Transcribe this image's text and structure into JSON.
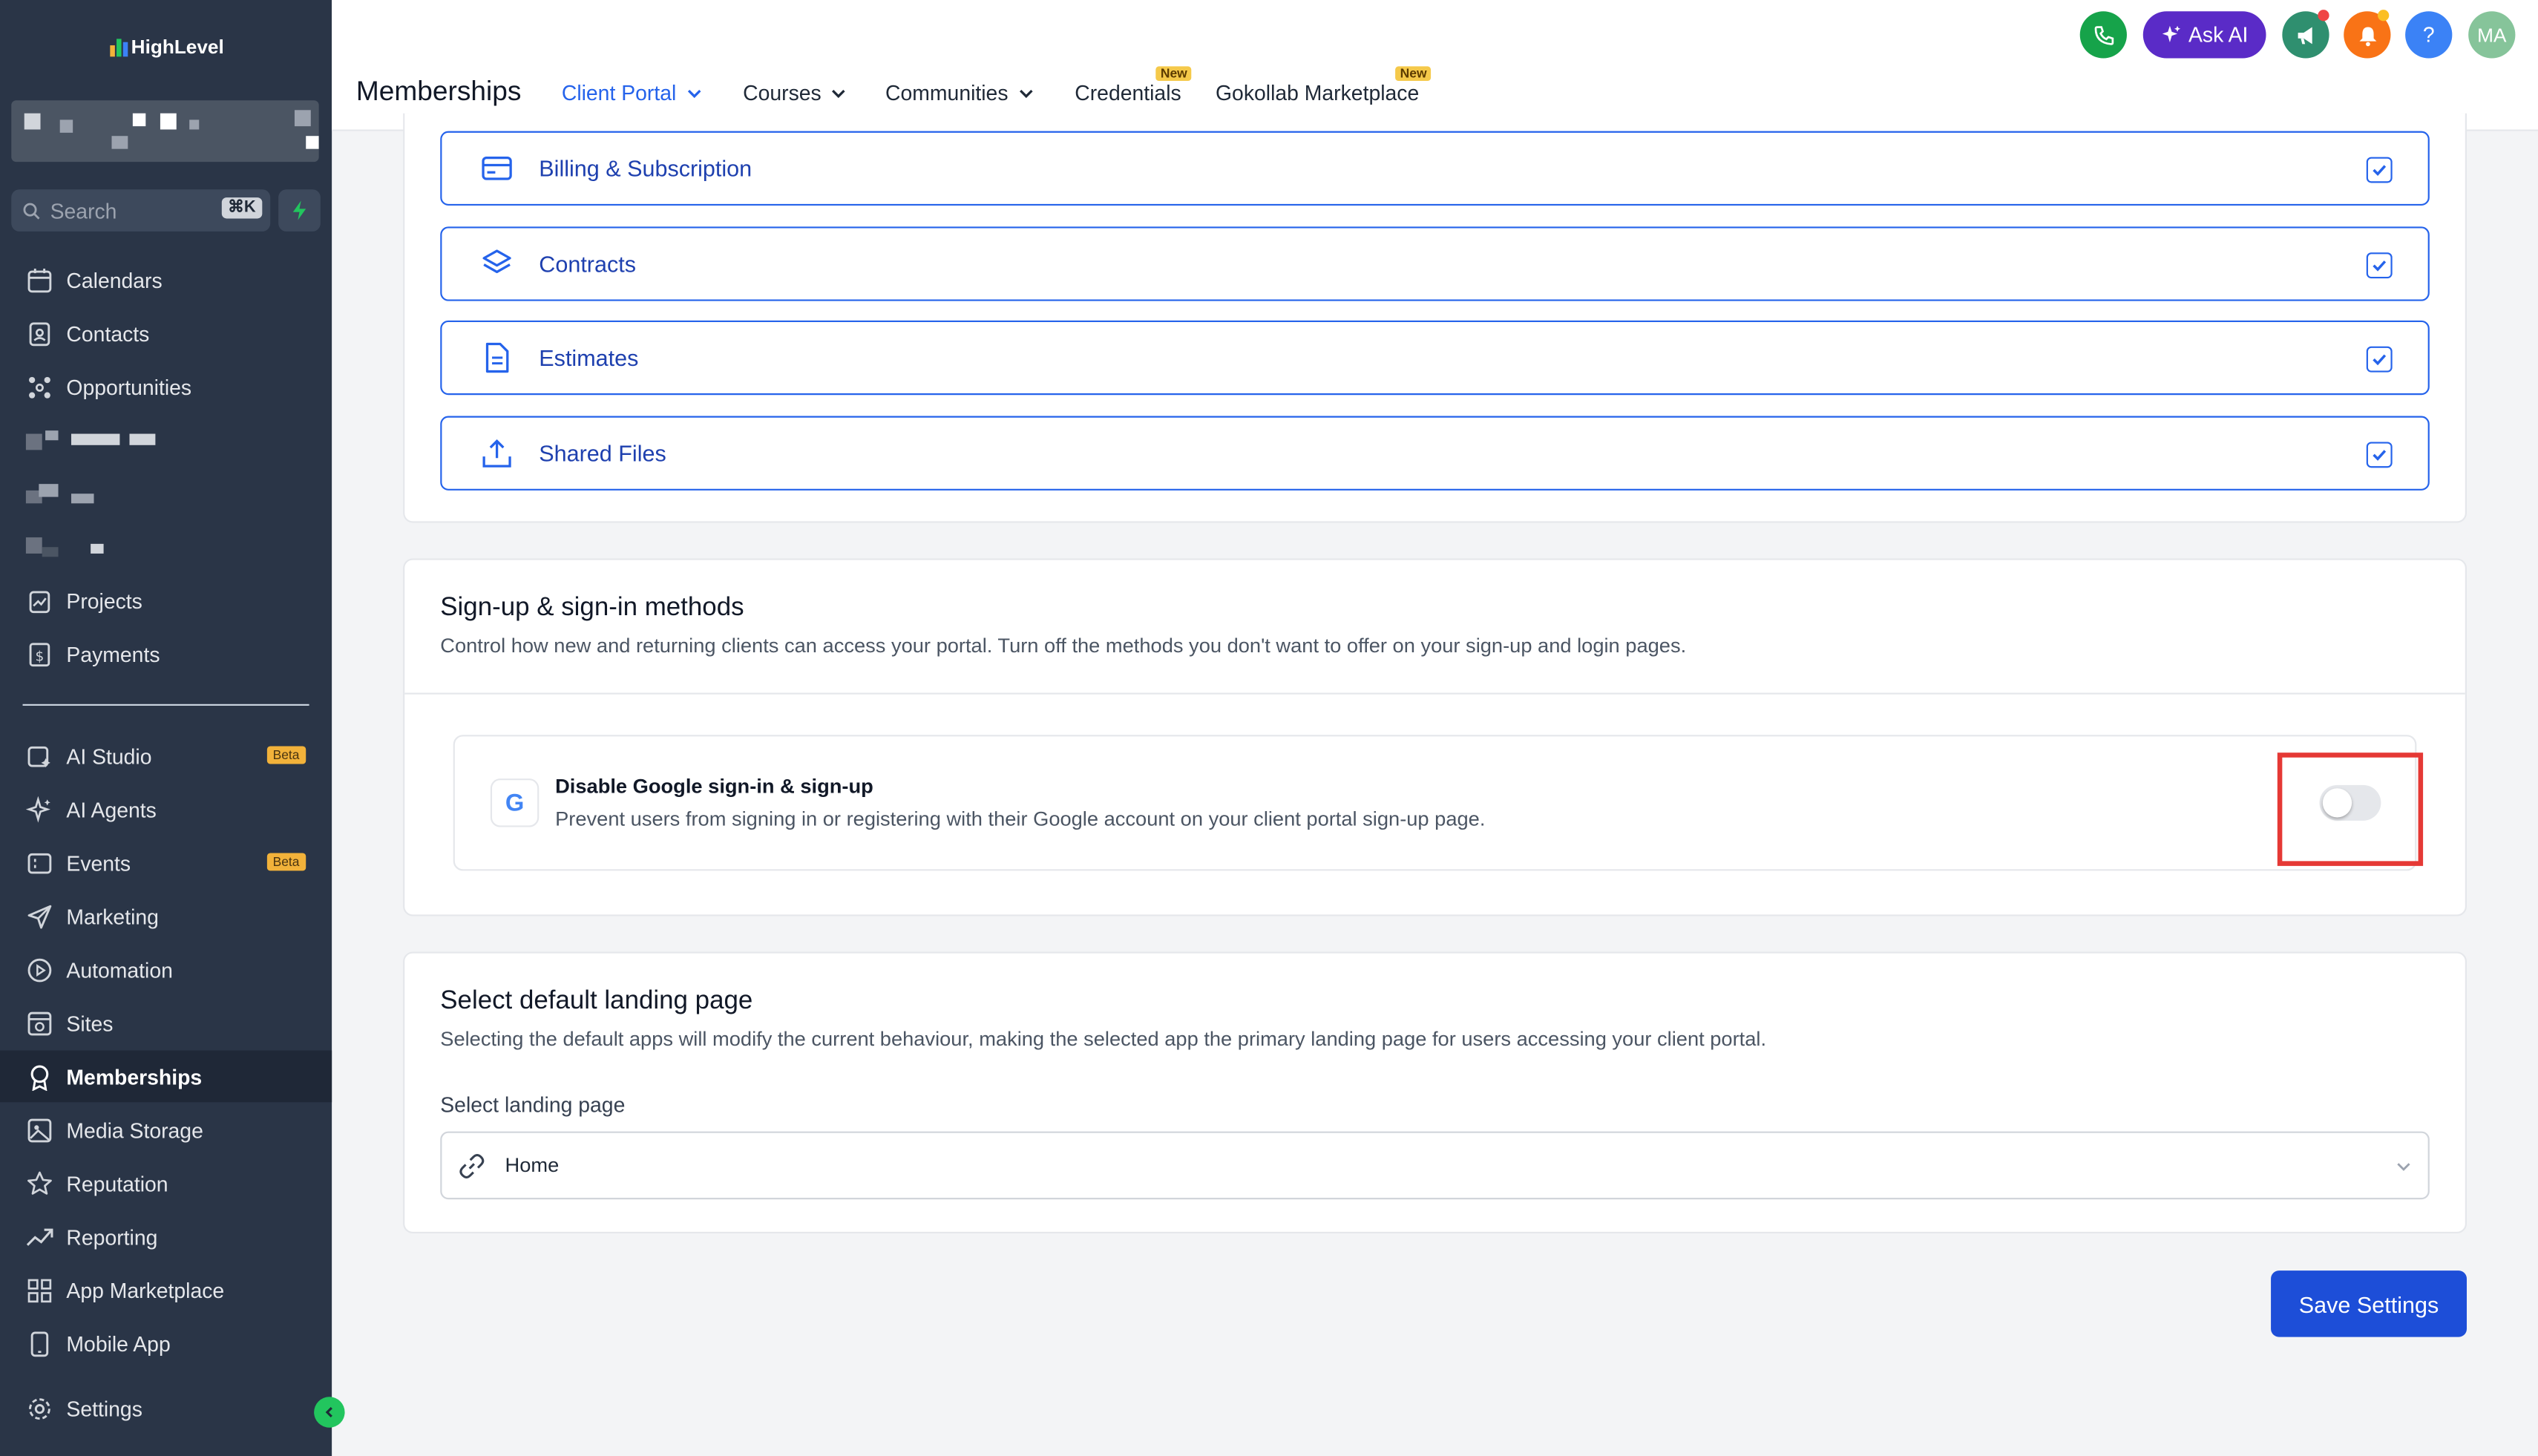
{
  "brand": {
    "name": "HighLevel"
  },
  "sidebar": {
    "search_placeholder": "Search",
    "search_shortcut": "⌘K",
    "items": [
      {
        "label": "Calendars",
        "icon": "calendar-icon"
      },
      {
        "label": "Contacts",
        "icon": "contacts-icon"
      },
      {
        "label": "Opportunities",
        "icon": "opportunities-icon"
      },
      {
        "label": "Projects",
        "icon": "projects-icon"
      },
      {
        "label": "Payments",
        "icon": "payments-icon"
      },
      {
        "label": "AI Studio",
        "icon": "ai-studio-icon",
        "badge": "Beta"
      },
      {
        "label": "AI Agents",
        "icon": "ai-agents-icon"
      },
      {
        "label": "Events",
        "icon": "events-icon",
        "badge": "Beta"
      },
      {
        "label": "Marketing",
        "icon": "marketing-icon"
      },
      {
        "label": "Automation",
        "icon": "automation-icon"
      },
      {
        "label": "Sites",
        "icon": "sites-icon"
      },
      {
        "label": "Memberships",
        "icon": "memberships-icon",
        "active": true
      },
      {
        "label": "Media Storage",
        "icon": "media-storage-icon"
      },
      {
        "label": "Reputation",
        "icon": "reputation-icon"
      },
      {
        "label": "Reporting",
        "icon": "reporting-icon"
      },
      {
        "label": "App Marketplace",
        "icon": "app-marketplace-icon"
      },
      {
        "label": "Mobile App",
        "icon": "mobile-app-icon"
      },
      {
        "label": "Settings",
        "icon": "settings-icon"
      }
    ]
  },
  "header": {
    "title": "Memberships",
    "tabs": [
      {
        "label": "Client Portal",
        "active": true
      },
      {
        "label": "Courses"
      },
      {
        "label": "Communities"
      },
      {
        "label": "Credentials",
        "badge": "New"
      },
      {
        "label": "Gokollab Marketplace",
        "badge": "New"
      }
    ],
    "ask_ai": "Ask AI",
    "help": "?",
    "avatar": "MA"
  },
  "features": [
    {
      "label": "Billing & Subscription",
      "checked": true
    },
    {
      "label": "Contracts",
      "checked": true
    },
    {
      "label": "Estimates",
      "checked": true
    },
    {
      "label": "Shared Files",
      "checked": true
    }
  ],
  "signin_section": {
    "title": "Sign-up & sign-in methods",
    "description": "Control how new and returning clients can access your portal. Turn off the methods you don't want to offer on your sign-up and login pages.",
    "google": {
      "icon_letter": "G",
      "title": "Disable Google sign-in & sign-up",
      "description": "Prevent users from signing in or registering with their Google account on your client portal sign-up page.",
      "enabled": false
    }
  },
  "landing_section": {
    "title": "Select default landing page",
    "description": "Selecting the default apps will modify the current behaviour, making the selected app the primary landing page for users accessing your client portal.",
    "field_label": "Select landing page",
    "selected": "Home"
  },
  "save_button": "Save Settings",
  "colors": {
    "sidebar_bg": "#2a3547",
    "accent": "#2563eb",
    "save": "#1d4ed8",
    "highlight": "#e53935"
  }
}
